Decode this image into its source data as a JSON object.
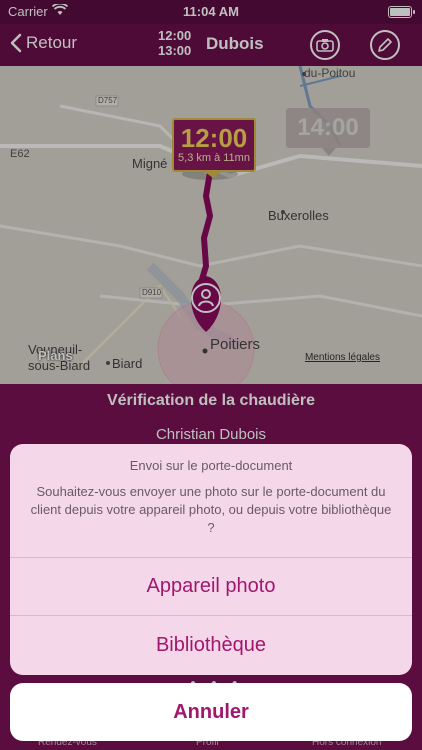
{
  "status": {
    "carrier": "Carrier",
    "time": "11:04 AM"
  },
  "nav": {
    "back_label": "Retour",
    "time_start": "12:00",
    "time_end": "13:00",
    "client": "Dubois"
  },
  "map": {
    "pill_time": "12:00",
    "pill_detail": "5,3 km à 11mn",
    "ghost_time": "14:00",
    "labels": {
      "poitou": "du-Poitou",
      "d757": "D757",
      "e62": "E62",
      "migne": "Migné",
      "buxerolles": "Buxerolles",
      "d910": "D910",
      "poitiers": "Poitiers",
      "vouneuil": "Vouneuil-",
      "sous_biard": "sous-Biard",
      "biard": "Biard"
    },
    "plans": "Plans",
    "legal": "Mentions légales"
  },
  "info": {
    "title": "Vérification de la chaudière",
    "client_full": "Christian Dubois"
  },
  "sheet": {
    "title": "Envoi sur le porte-document",
    "message": "Souhaitez-vous envoyer une photo sur le porte-document du client depuis votre appareil photo, ou depuis votre bibliothèque ?",
    "option_camera": "Appareil photo",
    "option_library": "Bibliothèque",
    "cancel": "Annuler"
  },
  "tabs": {
    "rdv": "Rendez-vous",
    "profil": "Profil",
    "hors": "Hors connexion"
  },
  "colors": {
    "brand": "#6a0f4a",
    "accent": "#a0186e",
    "sheet": "#f5d7ea"
  }
}
